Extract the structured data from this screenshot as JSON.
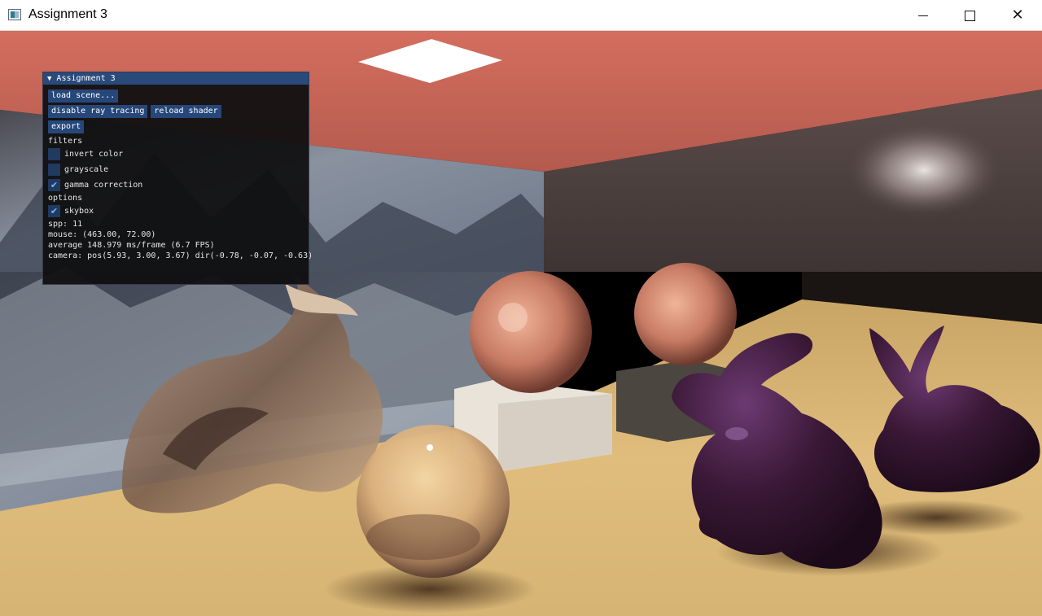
{
  "window": {
    "title": "Assignment 3",
    "minimize_icon": "minimize-icon",
    "maximize_icon": "maximize-icon",
    "close_icon": "close-icon",
    "close_glyph": "✕"
  },
  "panel": {
    "title": "Assignment 3",
    "collapse_glyph": "▼",
    "buttons": {
      "load_scene": "load scene...",
      "disable_ray_tracing": "disable ray tracing",
      "reload_shader": "reload shader",
      "export": "export"
    },
    "filters_label": "filters",
    "filters": [
      {
        "label": "invert color",
        "checked": false
      },
      {
        "label": "grayscale",
        "checked": false
      },
      {
        "label": "gamma correction",
        "checked": true
      }
    ],
    "options_label": "options",
    "options": [
      {
        "label": "skybox",
        "checked": true
      }
    ],
    "check_glyph": "✔",
    "stats": {
      "spp": "spp: 11",
      "mouse": "mouse: (463.00, 72.00)",
      "average": "average 148.979 ms/frame (6.7 FPS)",
      "camera": "camera: pos(5.93, 3.00, 3.67) dir(-0.78, -0.07, -0.63)"
    }
  },
  "colors": {
    "titlebar_bg": "#ffffff",
    "panel_bg": "#0f0f10",
    "panel_title_bg": "#294a7a",
    "button_bg": "#26477a",
    "checkbox_bg": "#203a60",
    "check_mark": "#7fb2ff",
    "ceiling": "#c86a5c",
    "floor": "#d9b676",
    "bunny": "#3a1533"
  }
}
